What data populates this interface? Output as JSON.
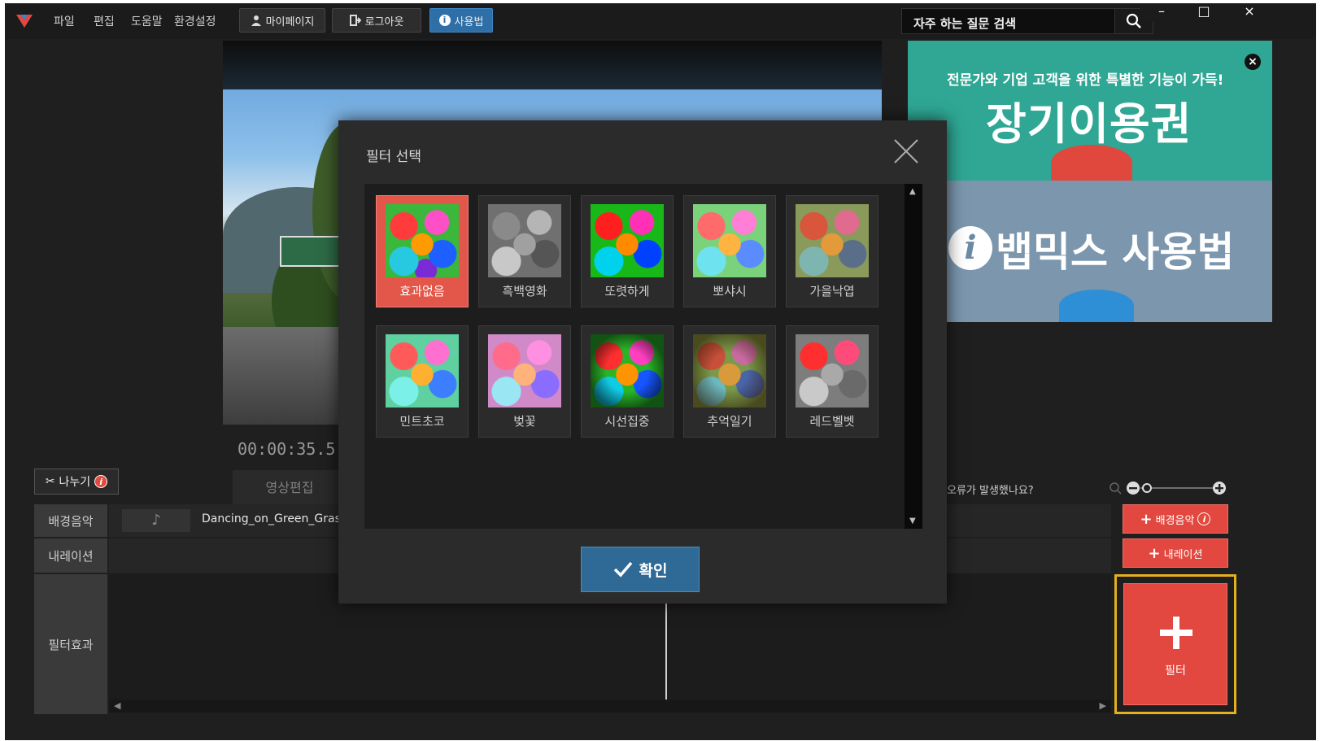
{
  "menu": {
    "items": [
      "파일",
      "편집",
      "도움말",
      "환경설정"
    ]
  },
  "toolbar": {
    "mypage": "마이페이지",
    "logout": "로그아웃",
    "howto": "사용법"
  },
  "search": {
    "placeholder": "자주 하는 질문 검색"
  },
  "window_controls": {
    "minimize": "–",
    "maximize": "□",
    "close": "×"
  },
  "player": {
    "timecode": "00:00:35.5"
  },
  "ad": {
    "top_line": "전문가와 기업 고객을 위한 특별한 기능이 가득!",
    "top_title": "장기이용권",
    "bottom_title": "뱁믹스 사용법",
    "info_glyph": "i"
  },
  "timeline": {
    "cut_label": "나누기",
    "tab_label": "영상편집",
    "error_question": "오류가 발생했나요?",
    "tracks": [
      "배경음악",
      "내레이션",
      "필터효과"
    ],
    "music_clip": "Dancing_on_Green_Grass",
    "add_music": "배경음악",
    "add_narration": "내레이션",
    "add_filter": "필터"
  },
  "dialog": {
    "title": "필터 선택",
    "confirm": "확인",
    "filters": [
      "효과없음",
      "흑백영화",
      "또렷하게",
      "뽀샤시",
      "가을낙엽",
      "민트초코",
      "벚꽃",
      "시선집중",
      "추억일기",
      "레드벨벳"
    ],
    "selected": "효과없음"
  },
  "colors": {
    "accent_red": "#e2483f",
    "accent_blue": "#2f6a96",
    "highlight": "#e3b020"
  }
}
